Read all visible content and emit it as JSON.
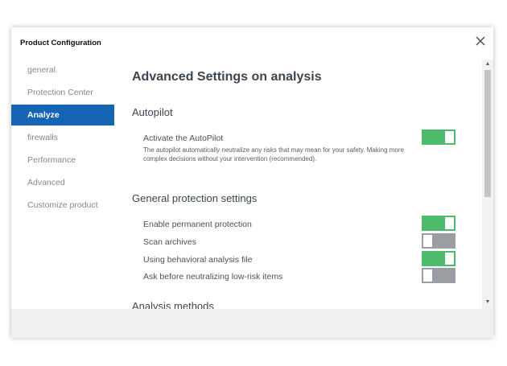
{
  "window": {
    "title": "Product Configuration"
  },
  "sidebar": {
    "items": [
      {
        "label": "general",
        "active": false
      },
      {
        "label": "Protection Center",
        "active": false
      },
      {
        "label": "Analyze",
        "active": true
      },
      {
        "label": "firewalls",
        "active": false
      },
      {
        "label": "Performance",
        "active": false
      },
      {
        "label": "Advanced",
        "active": false
      },
      {
        "label": "Customize product",
        "active": false
      }
    ]
  },
  "main": {
    "heading": "Advanced Settings on analysis",
    "autopilot": {
      "title": "Autopilot",
      "setting_label": "Activate the AutoPilot",
      "description": "The autopilot automatically neutralize any risks that may mean for your safety. Making more complex decisions without your intervention (recommended).",
      "enabled": true
    },
    "general_protection": {
      "title": "General protection settings",
      "settings": [
        {
          "label": "Enable permanent protection",
          "enabled": true
        },
        {
          "label": "Scan archives",
          "enabled": false
        },
        {
          "label": "Using behavioral analysis file",
          "enabled": true
        },
        {
          "label": "Ask before neutralizing low-risk items",
          "enabled": false
        }
      ]
    },
    "next_section_title": "Analysis methods"
  },
  "colors": {
    "accent": "#1565b4",
    "toggle_on": "#4cbb6b",
    "toggle_off": "#9a9da1",
    "footer_bg": "#f0f0f0"
  },
  "icons": {
    "close": "close-icon",
    "scroll_up": "chevron-up-icon",
    "scroll_down": "chevron-down-icon"
  }
}
